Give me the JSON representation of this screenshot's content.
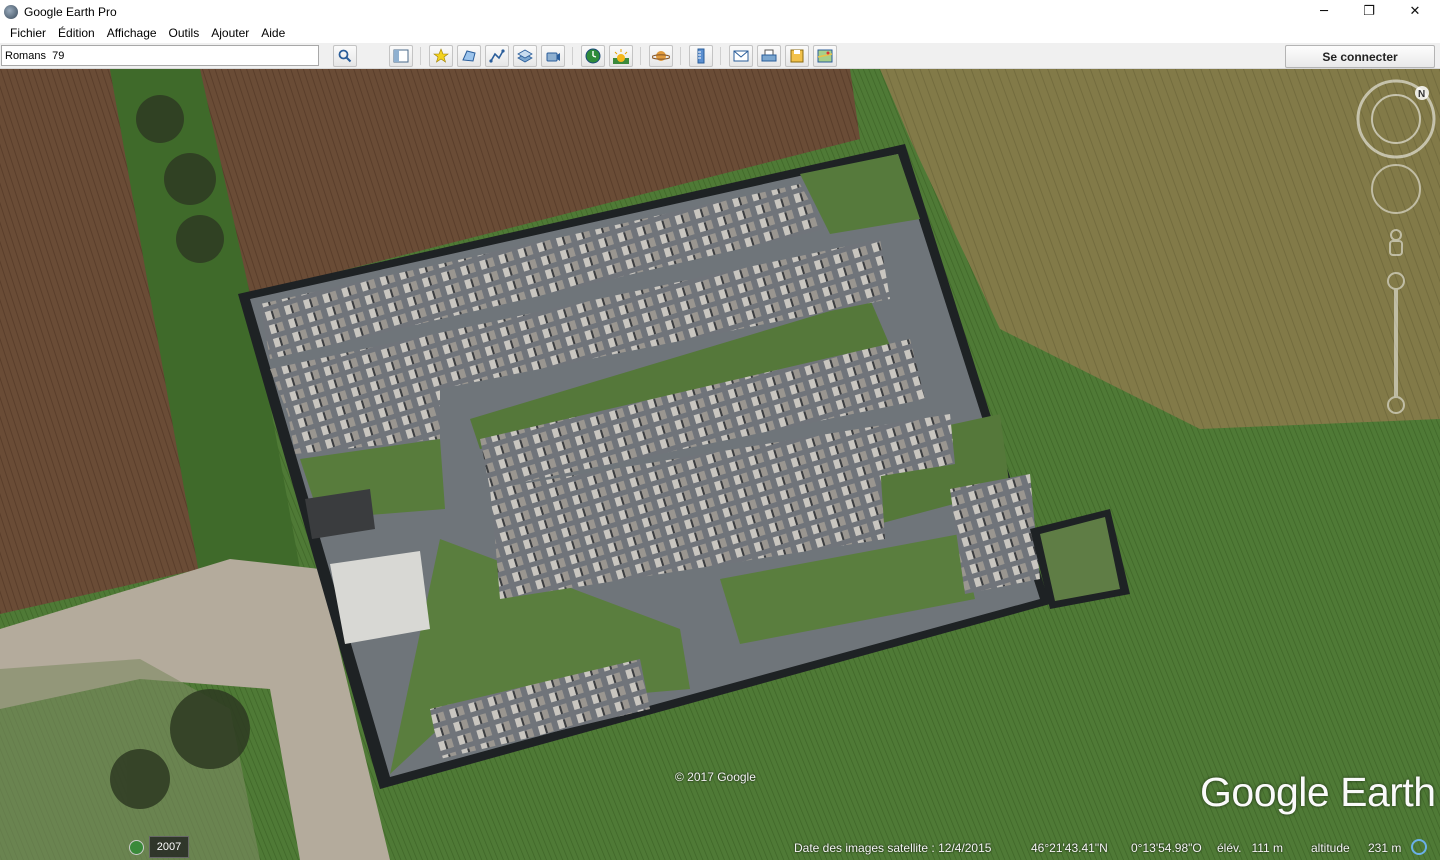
{
  "app": {
    "title": "Google Earth Pro",
    "window_controls": [
      "─",
      "❐",
      "✕"
    ]
  },
  "menu": {
    "items": [
      "Fichier",
      "Édition",
      "Affichage",
      "Outils",
      "Ajouter",
      "Aide"
    ]
  },
  "toolbar": {
    "search_value": "Romans  79",
    "search_button_icon": "search-icon",
    "icons": [
      "sidebar-icon",
      "placemark-icon",
      "polygon-icon",
      "path-icon",
      "overlay-icon",
      "tour-icon",
      "historical-imagery-icon",
      "sunlight-icon",
      "planets-icon",
      "ruler-icon",
      "email-icon",
      "print-icon",
      "save-image-icon",
      "map-view-icon"
    ],
    "signin_label": "Se connecter"
  },
  "map": {
    "copyright": "© 2017 Google",
    "brand": "Google Earth",
    "navigation": [
      "north-icon",
      "look-joystick-icon",
      "move-joystick-icon",
      "street-view-pegman-icon",
      "zoom-slider"
    ]
  },
  "status": {
    "year": "2007",
    "imagery_date": "Date des images satellite : 12/4/2015",
    "latitude": "46°21'43.41\"N",
    "longitude": "0°13'54.98\"O",
    "elevation": "élév.   111 m",
    "altitude_label": "altitude",
    "altitude_value": "231 m"
  },
  "colors": {
    "field_brown": "#6a4c36",
    "field_tan": "#8a7c4c",
    "grass_green": "#4e7a34",
    "gravel_gray": "#7e8288",
    "wall_dark": "#222",
    "accent_blue": "#3a6ea5"
  }
}
